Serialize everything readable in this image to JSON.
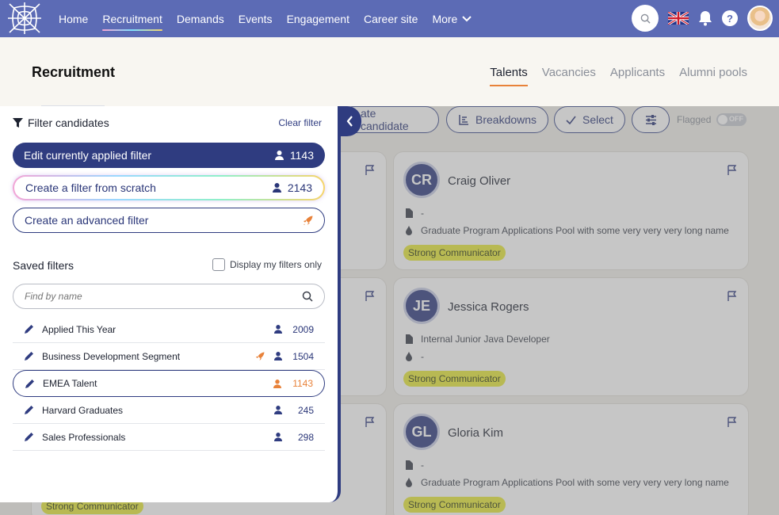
{
  "nav": {
    "items": [
      {
        "label": "Home"
      },
      {
        "label": "Recruitment",
        "active": true
      },
      {
        "label": "Demands"
      },
      {
        "label": "Events"
      },
      {
        "label": "Engagement"
      },
      {
        "label": "Career site"
      },
      {
        "label": "More"
      }
    ]
  },
  "header": {
    "title": "Recruitment",
    "tabs": [
      {
        "label": "Talents",
        "active": true
      },
      {
        "label": "Vacancies"
      },
      {
        "label": "Applicants"
      },
      {
        "label": "Alumni pools"
      }
    ]
  },
  "toolbar": {
    "create_candidate": "ate candidate",
    "breakdowns": "Breakdowns",
    "select": "Select",
    "flagged": "Flagged",
    "toggle": "OFF"
  },
  "cards": [
    {
      "initials": "CR",
      "name": "Craig Oliver",
      "line1": "-",
      "line2": "Graduate Program Applications Pool with some very very very long name",
      "tag": "Strong Communicator"
    },
    {
      "initials": "JE",
      "name": "Jessica Rogers",
      "line1": "Internal Junior Java Developer",
      "line2": "-",
      "tag": "Strong Communicator"
    },
    {
      "initials": "GL",
      "name": "Gloria Kim",
      "line1": "-",
      "line2": "Graduate Program Applications Pool with some very very very long name",
      "tag": "Strong Communicator"
    }
  ],
  "hidden_tag": "Strong Communicator",
  "filter": {
    "title": "Filter candidates",
    "clear": "Clear filter",
    "edit_label": "Edit currently applied filter",
    "edit_count": "1143",
    "scratch_label": "Create a filter from scratch",
    "scratch_count": "2143",
    "advanced_label": "Create an advanced filter",
    "saved_title": "Saved filters",
    "my_only": "Display my filters only",
    "search_placeholder": "Find by name",
    "saved": [
      {
        "label": "Applied This Year",
        "count": "2009",
        "advanced": false
      },
      {
        "label": "Business Development Segment",
        "count": "1504",
        "advanced": true
      },
      {
        "label": "EMEA Talent",
        "count": "1143",
        "advanced": false,
        "selected": true
      },
      {
        "label": "Harvard Graduates",
        "count": "245",
        "advanced": false
      },
      {
        "label": "Sales Professionals",
        "count": "298",
        "advanced": false
      }
    ]
  },
  "colors": {
    "nav": "#5c6bb5",
    "primary": "#2f3c80",
    "accent": "#e8823a",
    "tag": "#e7e93a"
  }
}
